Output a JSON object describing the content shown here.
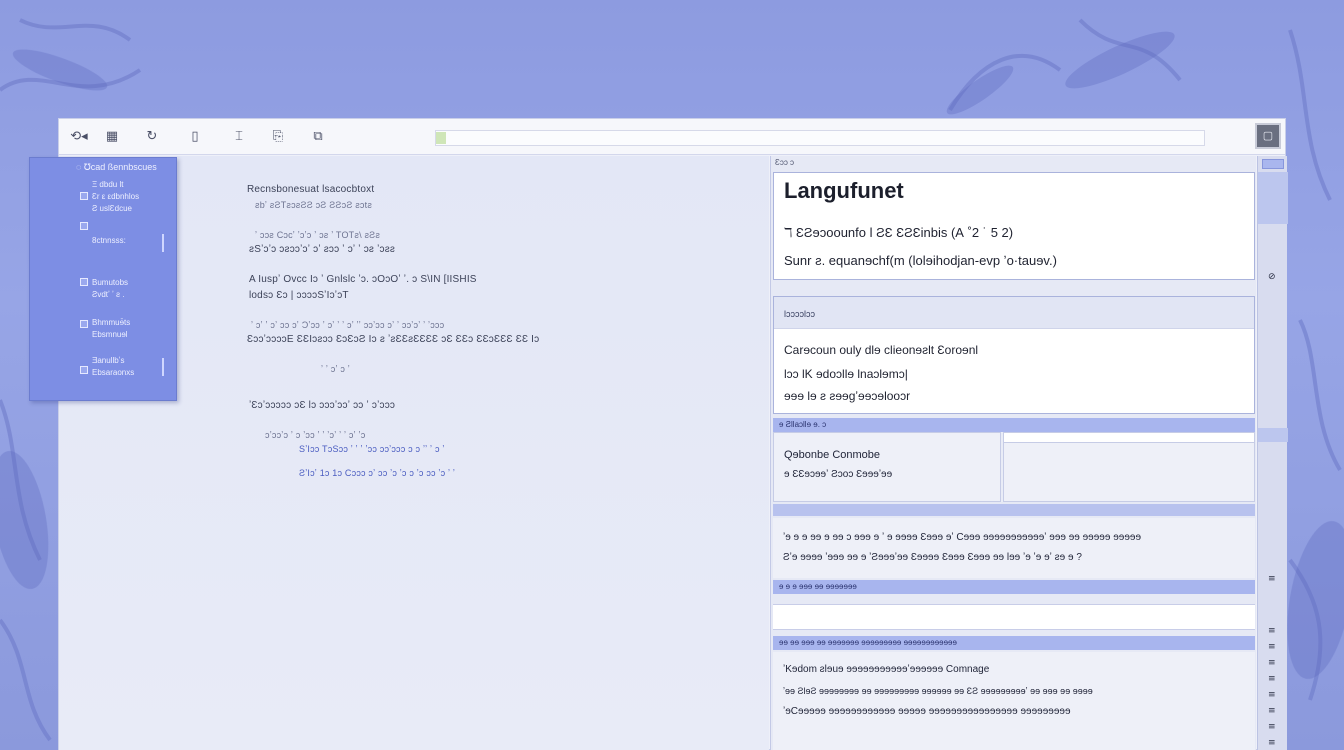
{
  "toolbar": {
    "icons": [
      "back-icon",
      "grid-icon",
      "refresh-icon",
      "page-icon",
      "bookmark-icon",
      "copy-icon",
      "share-icon"
    ],
    "icon_glyphs": [
      "⟲◂",
      "▦",
      "↻",
      "▯",
      "⌶",
      "⎘",
      "⧉"
    ],
    "menu_square_glyph": "▢"
  },
  "floating_panel": {
    "heading": "◌ ℧cad ßennbscues",
    "items": [
      "Ξ dbdu lt",
      "Ɛr ε εdbnhlos",
      "Ƨ uslƐdcue",
      "8ctnnsss:",
      "Bumutobs",
      "Ƨvdtʼ ʼ ƨ .",
      "Bhmmuɘ̄ts",
      "Ebsmnuɘl",
      "Ǝanullbʼs",
      "Ebsaraonxs"
    ]
  },
  "document": {
    "lines": [
      "Recnsbonesuat lsacocbtoxt",
      "ƨbʼ ƨƧTƨɔƨƧƧ ɔƧ ƧƧɔƧ ƨɔtƨ",
      "ʼ ɔɔƨ Cɔcʼ ʼɔʼɔ ʼ ɔƨ ʼ TOTƨ\\ ƨƧƨ",
      "ƨSʼɔʼɔ ɔƨɔɔʼɔʼ ɔʼ ƨɔɔ ʼ ɔʼ ʼ ɔƨ ʼɔƨƨ",
      "A Iuspʼ Ovcc Iɔ ʼ Gnlslc ʼɔ. ɔOɔOʼ ʼ. ɔ S\\IN [IISHIS",
      "lodsɔ Ɛɔ | ɔɔɔɔSʼIɔʼɔT",
      "ʼ ɔʼ ʼ ɔʼ ɔɔ ɔʼ Ɔʼɔɔ ʼ ɔʼ ʼ ʼ ɔʼ ʼʼ ɔɔʼɔɔ ɔʼ ʼ ɔɔʼɔʼ ʼ ʼɔɔɔ",
      "ƐɔɔʼɔɔɔɔE ƐƐIɔƨɔɔ ƐɔƐɔƧ Iɔ ƨ ʼƨƐƐƨƐƐƐƐ ɔƐ ƐƐɔ ƐƐɔƐƐƐ ƐƐ Iɔ",
      "ʼ ʼ ɔʼ ɔ ʼ",
      "ʼƐɔʼɔɔɔɔɔ ɔƐ lɔ ɔɔɔʼɔɔʼ ɔɔ ʼ ɔʼɔɔɔ",
      "ɔʼɔɔʼɔ ʼ ɔ ʼɔɔ ʼ ʼ ʼɔʼ ʼ ʼ ɔʼ ʼɔ",
      "SʼIɔɔ TɔSɔɔ ʼ ʼ ʼ ʼɔɔ ɔɔʼɔɔɔ ɔ ɔ ʼʼ ʼ ɔ ʼ",
      "ƧʼIɔʼ 1ɔ 1ɔ Cɔɔɔ ɔʼ ɔɔ ʼɔ ʼɔ ɔ ʼɔ ɔɔ ʼɔ ʼ ʼ"
    ]
  },
  "side_panel": {
    "top_label": "Ɛɔɔ ɔ",
    "title": "Langufunet",
    "subtitle_1": "ℸ ƐƧɘɔoounfo l ƧƐ ƐƧƐinbis (А ˚2 ˙ 5 2)",
    "subtitle_2": "Sunr ƨ. equanɘchf(m (lolɘihodjan-evp ʼo·tauɘv.)",
    "section_header": "lɔɔɔɔlɔɔ",
    "section_lines": [
      "Carɘcoun ouly dlɘ clieonɘƨlt Ɛoroɘnl",
      "lɔɔ lK ɘdoɔllɘ lnaɔlɘmɔ|",
      "ɘɘɘ lɘ ƨ ƨɘɘgʼɘɘɔɘlooɔr"
    ],
    "band_1": "ɘ Ƨllaɔllɘ ɘ. ɔ",
    "split_left_lines": [
      "Qɘbonbe Conmobe",
      "ɘ ƐƐɘɔɘɘʼ Ƨɔoɔ Ɛɘɘɘʼɘɘ"
    ],
    "text_block_1": [
      "ʼɘ ɘ ɘ ɘɘ ɘ ɘɘ ɔ ɘɘɘ ɘ ʼ ɘ ɘɘɘɘ Ɛɘɘɘ ɘʼ Cɘɘɘ ɘɘɘɘɘɘɘɘɘɘɘʼ ɘɘɘ ɘɘ ɘɘɘɘɘ ɘɘɘɘɘ",
      "Ƨʼɘ ɘɘɘɘ ʼɘɘɘ ɘɘ ɘ ʼƧɘɘɘʼɘɘ Ɛɘɘɘɘ Ɛɘɘɘ Ɛɘɘɘ ɘɘ lɘɘ ʼɘ ʼɘ ɘʼ ƨɘ ɘ ?"
    ],
    "band_2": "ɘ ɘ ɘ ɘɘɘ ɘɘ ɘɘɘɘɘɘɘ",
    "band_3": "ɘɘ ɘɘ ɘɘɘ ɘɘ ɘɘɘɘɘɘɘ ɘɘɘɘɘɘɘɘɘ ɘɘɘɘɘɘɘɘɘɘɘɘ",
    "text_block_2": [
      "ʼKɘdom ƨlɘuɘ ɘɘɘɘɘɘɘɘɘɘɘʼɘɘɘɘɘɘ Comnage",
      "ʼɘɘ ƧlɘƧ ɘɘɘɘɘɘɘɘ ɘɘ ɘɘɘɘɘɘɘɘɘ ɘɘɘɘɘɘ ɘɘ ƐƧ ɘɘɘɘɘɘɘɘɘʼ ɘɘ ɘɘɘ ɘɘ ɘɘɘɘ",
      "ʼɘCɘɘɘɘɘ ɘɘɘɘɘɘɘɘɘɘɘɘ ɘɘɘɘɘ ɘɘɘɘɘɘɘɘɘɘɘɘɘɘɘɘ ɘɘɘɘɘɘɘɘɘ"
    ]
  },
  "rail": {
    "icon_glyphs": [
      "⊘",
      "≡",
      "≡",
      "≡",
      "≡",
      "≡",
      "≡",
      "≡",
      "≡",
      "≡"
    ]
  }
}
